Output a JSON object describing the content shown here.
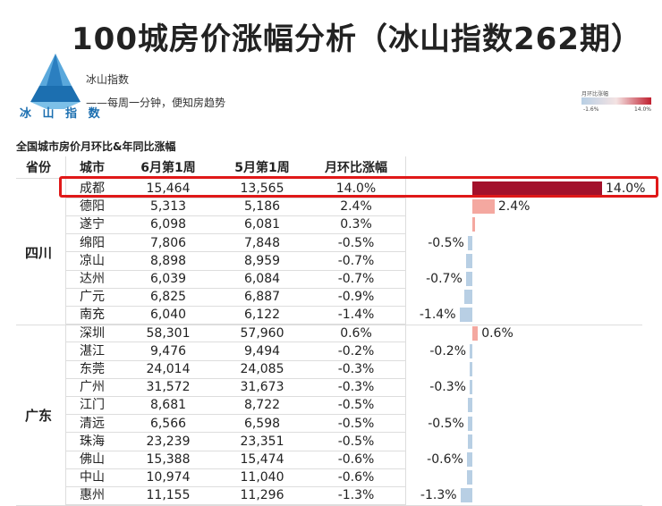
{
  "header": {
    "title": "100城房价涨幅分析（冰山指数262期）",
    "brand": "冰山指数",
    "slogan": "——每周一分钟，便知房趋势",
    "logo_text": "冰 山 指 数"
  },
  "legend": {
    "title": "月环比涨幅",
    "min_label": "-1.6%",
    "max_label": "14.0%"
  },
  "colors": {
    "positive_strong": "#a3112b",
    "positive_light": "#f4a8a0",
    "negative": "#b8cfe4",
    "highlight": "#e01818"
  },
  "chart_data": {
    "type": "table",
    "title": "全国城市房价月环比&年同比涨幅",
    "columns": [
      "省份",
      "城市",
      "6月第1周",
      "5月第1周",
      "月环比涨幅"
    ],
    "groups": [
      {
        "province": "四川",
        "rows": [
          {
            "city": "成都",
            "june": "15,464",
            "may": "13,565",
            "mom": "14.0%",
            "value": 14.0,
            "show_label": true
          },
          {
            "city": "德阳",
            "june": "5,313",
            "may": "5,186",
            "mom": "2.4%",
            "value": 2.4,
            "show_label": true
          },
          {
            "city": "遂宁",
            "june": "6,098",
            "may": "6,081",
            "mom": "0.3%",
            "value": 0.3,
            "show_label": false
          },
          {
            "city": "绵阳",
            "june": "7,806",
            "may": "7,848",
            "mom": "-0.5%",
            "value": -0.5,
            "show_label": true
          },
          {
            "city": "凉山",
            "june": "8,898",
            "may": "8,959",
            "mom": "-0.7%",
            "value": -0.7,
            "show_label": false
          },
          {
            "city": "达州",
            "june": "6,039",
            "may": "6,084",
            "mom": "-0.7%",
            "value": -0.7,
            "show_label": true
          },
          {
            "city": "广元",
            "june": "6,825",
            "may": "6,887",
            "mom": "-0.9%",
            "value": -0.9,
            "show_label": false
          },
          {
            "city": "南充",
            "june": "6,040",
            "may": "6,122",
            "mom": "-1.4%",
            "value": -1.4,
            "show_label": true
          }
        ]
      },
      {
        "province": "广东",
        "rows": [
          {
            "city": "深圳",
            "june": "58,301",
            "may": "57,960",
            "mom": "0.6%",
            "value": 0.6,
            "show_label": true
          },
          {
            "city": "湛江",
            "june": "9,476",
            "may": "9,494",
            "mom": "-0.2%",
            "value": -0.2,
            "show_label": true
          },
          {
            "city": "东莞",
            "june": "24,014",
            "may": "24,085",
            "mom": "-0.3%",
            "value": -0.3,
            "show_label": false
          },
          {
            "city": "广州",
            "june": "31,572",
            "may": "31,673",
            "mom": "-0.3%",
            "value": -0.3,
            "show_label": true
          },
          {
            "city": "江门",
            "june": "8,681",
            "may": "8,722",
            "mom": "-0.5%",
            "value": -0.5,
            "show_label": false
          },
          {
            "city": "清远",
            "june": "6,566",
            "may": "6,598",
            "mom": "-0.5%",
            "value": -0.5,
            "show_label": true
          },
          {
            "city": "珠海",
            "june": "23,239",
            "may": "23,351",
            "mom": "-0.5%",
            "value": -0.5,
            "show_label": false
          },
          {
            "city": "佛山",
            "june": "15,388",
            "may": "15,474",
            "mom": "-0.6%",
            "value": -0.6,
            "show_label": true
          },
          {
            "city": "中山",
            "june": "10,974",
            "may": "11,040",
            "mom": "-0.6%",
            "value": -0.6,
            "show_label": false
          },
          {
            "city": "惠州",
            "june": "11,155",
            "may": "11,296",
            "mom": "-1.3%",
            "value": -1.3,
            "show_label": true
          }
        ]
      }
    ]
  }
}
